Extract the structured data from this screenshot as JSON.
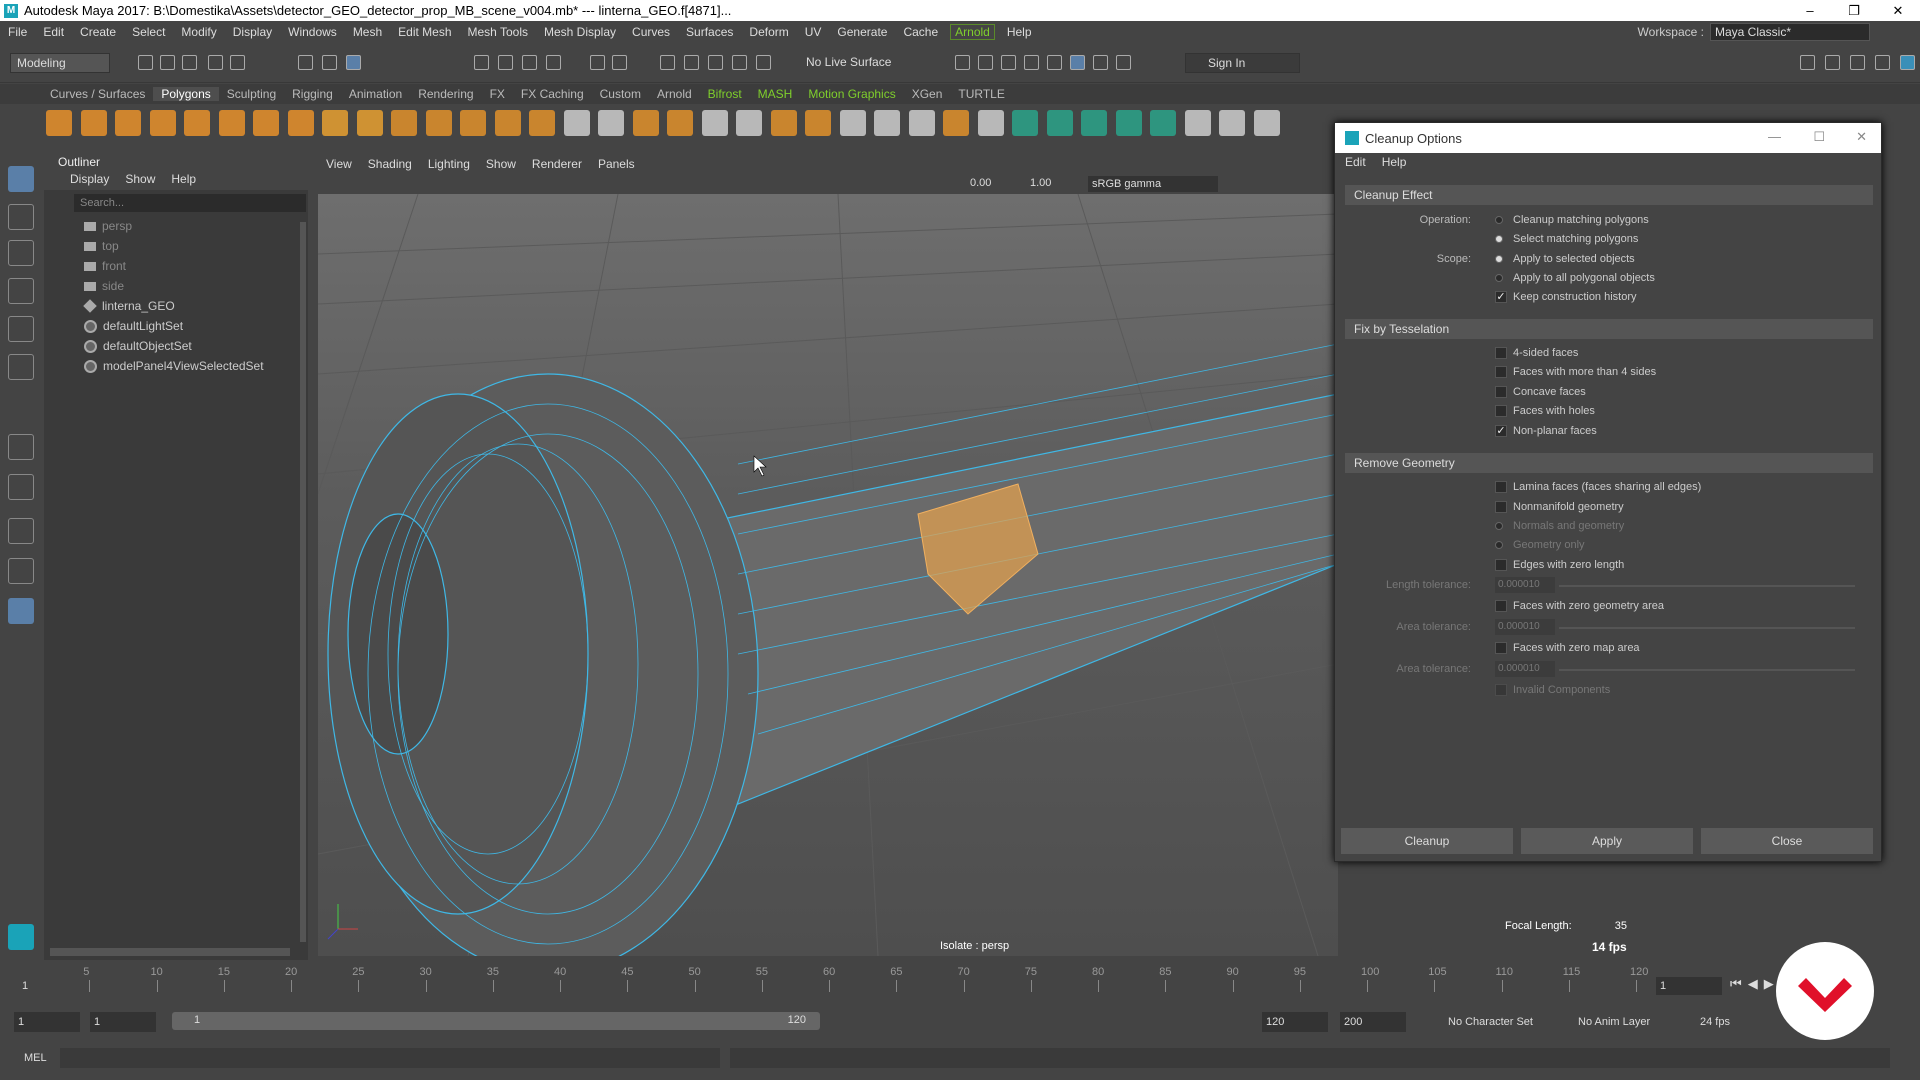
{
  "title": "Autodesk Maya 2017: B:\\Domestika\\Assets\\detector_GEO_detector_prop_MB_scene_v004.mb*   ---   linterna_GEO.f[4871]...",
  "menubar": [
    "File",
    "Edit",
    "Create",
    "Select",
    "Modify",
    "Display",
    "Windows",
    "Mesh",
    "Edit Mesh",
    "Mesh Tools",
    "Mesh Display",
    "Curves",
    "Surfaces",
    "Deform",
    "UV",
    "Generate",
    "Cache",
    "Arnold",
    "Help"
  ],
  "workspace": {
    "label": "Workspace :",
    "value": "Maya Classic*"
  },
  "statusline": {
    "mode": "Modeling",
    "live_surface": "No Live Surface",
    "sign_in": "Sign In"
  },
  "shelf_tabs": [
    "Curves / Surfaces",
    "Polygons",
    "Sculpting",
    "Rigging",
    "Animation",
    "Rendering",
    "FX",
    "FX Caching",
    "Custom",
    "Arnold",
    "Bifrost",
    "MASH",
    "Motion Graphics",
    "XGen",
    "TURTLE"
  ],
  "outliner": {
    "title": "Outliner",
    "menu": [
      "Display",
      "Show",
      "Help"
    ],
    "search_placeholder": "Search...",
    "items": [
      "persp",
      "top",
      "front",
      "side",
      "linterna_GEO",
      "defaultLightSet",
      "defaultObjectSet",
      "modelPanel4ViewSelectedSet"
    ]
  },
  "viewport": {
    "menu": [
      "View",
      "Shading",
      "Lighting",
      "Show",
      "Renderer",
      "Panels"
    ],
    "field1": "0.00",
    "field2": "1.00",
    "colorspace": "sRGB gamma",
    "isolate_label": "Isolate : persp",
    "focal_label": "Focal Length:",
    "focal_value": "35",
    "fps": "14 fps"
  },
  "dialog": {
    "title": "Cleanup Options",
    "menu": [
      "Edit",
      "Help"
    ],
    "sec_effect": "Cleanup Effect",
    "operation_label": "Operation:",
    "op1": "Cleanup matching polygons",
    "op2": "Select matching polygons",
    "scope_label": "Scope:",
    "scope1": "Apply to selected objects",
    "scope2": "Apply to all polygonal objects",
    "keep_history": "Keep construction history",
    "sec_tess": "Fix by Tesselation",
    "t1": "4-sided faces",
    "t2": "Faces with more than 4 sides",
    "t3": "Concave faces",
    "t4": "Faces with holes",
    "t5": "Non-planar faces",
    "sec_remove": "Remove Geometry",
    "r1": "Lamina faces (faces sharing all edges)",
    "r2": "Nonmanifold geometry",
    "r2a": "Normals and geometry",
    "r2b": "Geometry only",
    "r3": "Edges with zero length",
    "len_tol_label": "Length tolerance:",
    "len_tol": "0.000010",
    "r4": "Faces with zero geometry area",
    "area_tol_label": "Area tolerance:",
    "area_tol": "0.000010",
    "r5": "Faces with zero map area",
    "map_tol_label": "Area tolerance:",
    "map_tol": "0.000010",
    "r6": "Invalid Components",
    "btn_cleanup": "Cleanup",
    "btn_apply": "Apply",
    "btn_close": "Close"
  },
  "timeline": {
    "ticks": [
      "5",
      "10",
      "15",
      "20",
      "25",
      "30",
      "35",
      "40",
      "45",
      "50",
      "55",
      "60",
      "65",
      "70",
      "75",
      "80",
      "85",
      "90",
      "95",
      "100",
      "105",
      "110",
      "115",
      "120"
    ],
    "current_frame": "1",
    "start_tick": "1"
  },
  "range": {
    "start": "1",
    "start2": "1",
    "slider_start": "1",
    "slider_end": "120",
    "end": "120",
    "end2": "200",
    "char_set": "No Character Set",
    "anim_layer": "No Anim Layer",
    "fps": "24 fps"
  },
  "cmd": {
    "label": "MEL"
  },
  "colors": {
    "accent_green": "#7fcf2c",
    "wire": "#3fb8e6",
    "selected_faces": "#e0a050",
    "watermark_red": "#e0102a"
  }
}
